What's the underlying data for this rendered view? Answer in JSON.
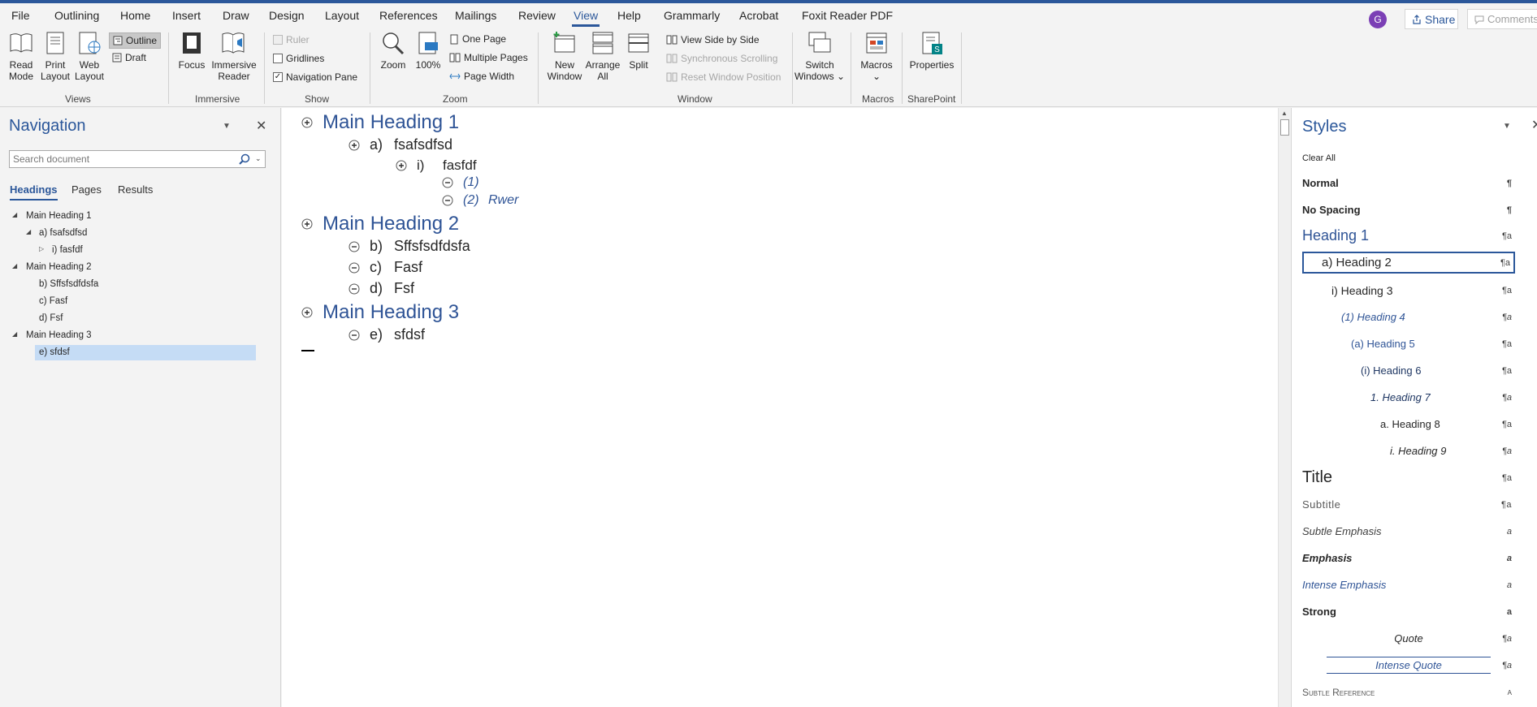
{
  "menu": {
    "tabs": [
      "File",
      "Outlining",
      "Home",
      "Insert",
      "Draw",
      "Design",
      "Layout",
      "References",
      "Mailings",
      "Review",
      "View",
      "Help",
      "Grammarly",
      "Acrobat",
      "Foxit Reader PDF"
    ],
    "active_tab": "View",
    "avatar_letter": "G",
    "share_label": "Share",
    "comments_label": "Comments"
  },
  "ribbon": {
    "views": {
      "read_mode": "Read Mode",
      "print_layout": "Print Layout",
      "web_layout": "Web Layout",
      "outline": "Outline",
      "draft": "Draft",
      "label": "Views"
    },
    "immersive": {
      "focus": "Focus",
      "immersive_reader": "Immersive Reader",
      "label": "Immersive"
    },
    "show": {
      "ruler": "Ruler",
      "gridlines": "Gridlines",
      "navigation_pane": "Navigation Pane",
      "label": "Show"
    },
    "zoom": {
      "zoom": "Zoom",
      "percent": "100%",
      "one_page": "One Page",
      "multiple_pages": "Multiple Pages",
      "page_width": "Page Width",
      "label": "Zoom"
    },
    "window": {
      "new_window": "New Window",
      "arrange_all": "Arrange All",
      "split": "Split",
      "view_side_by_side": "View Side by Side",
      "synchronous_scrolling": "Synchronous Scrolling",
      "reset_window_position": "Reset Window Position",
      "switch_windows": "Switch Windows",
      "label": "Window"
    },
    "macros": {
      "macros": "Macros",
      "label": "Macros"
    },
    "sharepoint": {
      "properties": "Properties",
      "label": "SharePoint"
    }
  },
  "navigation": {
    "title": "Navigation",
    "search_placeholder": "Search document",
    "tabs": [
      "Headings",
      "Pages",
      "Results"
    ],
    "tree": [
      {
        "label": "Main Heading 1"
      },
      {
        "label": "a) fsafsdfsd"
      },
      {
        "label": "i) fasfdf"
      },
      {
        "label": "Main Heading 2"
      },
      {
        "label": "b) Sffsfsdfdsfa"
      },
      {
        "label": "c) Fasf"
      },
      {
        "label": "d) Fsf"
      },
      {
        "label": "Main Heading 3"
      },
      {
        "label": "e) sfdsf"
      }
    ]
  },
  "document": {
    "outline": [
      {
        "num": "",
        "text": "Main Heading 1"
      },
      {
        "num": "a)",
        "text": "fsafsdfsd"
      },
      {
        "num": "i)",
        "text": "fasfdf"
      },
      {
        "num": "(1)",
        "text": ""
      },
      {
        "num": "(2)",
        "text": "Rwer"
      },
      {
        "num": "",
        "text": "Main Heading 2"
      },
      {
        "num": "b)",
        "text": "Sffsfsdfdsfa"
      },
      {
        "num": "c)",
        "text": "Fasf"
      },
      {
        "num": "d)",
        "text": "Fsf"
      },
      {
        "num": "",
        "text": "Main Heading 3"
      },
      {
        "num": "e)",
        "text": "sfdsf"
      }
    ]
  },
  "styles": {
    "title": "Styles",
    "items": [
      {
        "name": "Clear All",
        "mark": ""
      },
      {
        "name": "Normal",
        "mark": "¶"
      },
      {
        "name": "No Spacing",
        "mark": "¶"
      },
      {
        "name": "Heading 1",
        "mark": "¶a"
      },
      {
        "name": "a)  Heading 2",
        "mark": "¶a"
      },
      {
        "name": "i)  Heading 3",
        "mark": "¶a"
      },
      {
        "name": "(1)  Heading 4",
        "mark": "¶a"
      },
      {
        "name": "(a)  Heading 5",
        "mark": "¶a"
      },
      {
        "name": "(i)  Heading 6",
        "mark": "¶a"
      },
      {
        "name": "1.  Heading 7",
        "mark": "¶a"
      },
      {
        "name": "a.  Heading 8",
        "mark": "¶a"
      },
      {
        "name": "i.  Heading 9",
        "mark": "¶a"
      },
      {
        "name": "Title",
        "mark": "¶a"
      },
      {
        "name": "Subtitle",
        "mark": "¶a"
      },
      {
        "name": "Subtle Emphasis",
        "mark": "a"
      },
      {
        "name": "Emphasis",
        "mark": "a"
      },
      {
        "name": "Intense Emphasis",
        "mark": "a"
      },
      {
        "name": "Strong",
        "mark": "a"
      },
      {
        "name": "Quote",
        "mark": "¶a"
      },
      {
        "name": "Intense Quote",
        "mark": "¶a"
      },
      {
        "name": "Subtle Reference",
        "mark": "a"
      }
    ]
  },
  "colors": {
    "accent": "#2b579a",
    "heading": "#2f5496"
  }
}
